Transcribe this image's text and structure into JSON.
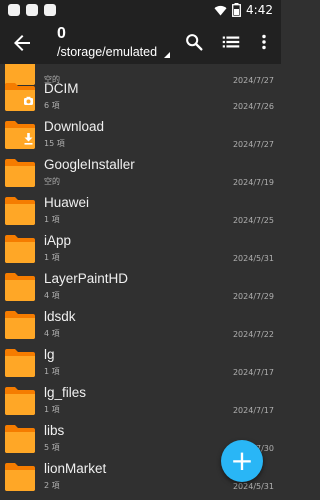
{
  "status_bar": {
    "time": "4:42"
  },
  "app_bar": {
    "count": "0",
    "path": "/storage/emulated"
  },
  "files": [
    {
      "name": "",
      "sub": "空的",
      "date": "2024/7/27",
      "badge": "none"
    },
    {
      "name": "DCIM",
      "sub": "6 項",
      "date": "2024/7/26",
      "badge": "camera"
    },
    {
      "name": "Download",
      "sub": "15 項",
      "date": "2024/7/27",
      "badge": "download"
    },
    {
      "name": "GoogleInstaller",
      "sub": "空的",
      "date": "2024/7/19",
      "badge": "none"
    },
    {
      "name": "Huawei",
      "sub": "1 項",
      "date": "2024/7/25",
      "badge": "none"
    },
    {
      "name": "iApp",
      "sub": "1 項",
      "date": "2024/5/31",
      "badge": "none"
    },
    {
      "name": "LayerPaintHD",
      "sub": "4 項",
      "date": "2024/7/29",
      "badge": "none"
    },
    {
      "name": "ldsdk",
      "sub": "4 項",
      "date": "2024/7/22",
      "badge": "none"
    },
    {
      "name": "lg",
      "sub": "1 項",
      "date": "2024/7/17",
      "badge": "none"
    },
    {
      "name": "lg_files",
      "sub": "1 項",
      "date": "2024/7/17",
      "badge": "none"
    },
    {
      "name": "libs",
      "sub": "5 項",
      "date": "2024/7/30",
      "badge": "none"
    },
    {
      "name": "lionMarket",
      "sub": "2 項",
      "date": "2024/5/31",
      "badge": "none"
    }
  ],
  "fab": {
    "label": "+"
  },
  "colors": {
    "folder": "#ffa726",
    "folder_back": "#f57c00",
    "fab": "#29b6f6",
    "bar": "#212121",
    "background": "#303030"
  },
  "icons": {
    "back": "arrow-back-icon",
    "search": "search-icon",
    "view": "list-view-icon",
    "more": "more-vert-icon"
  }
}
